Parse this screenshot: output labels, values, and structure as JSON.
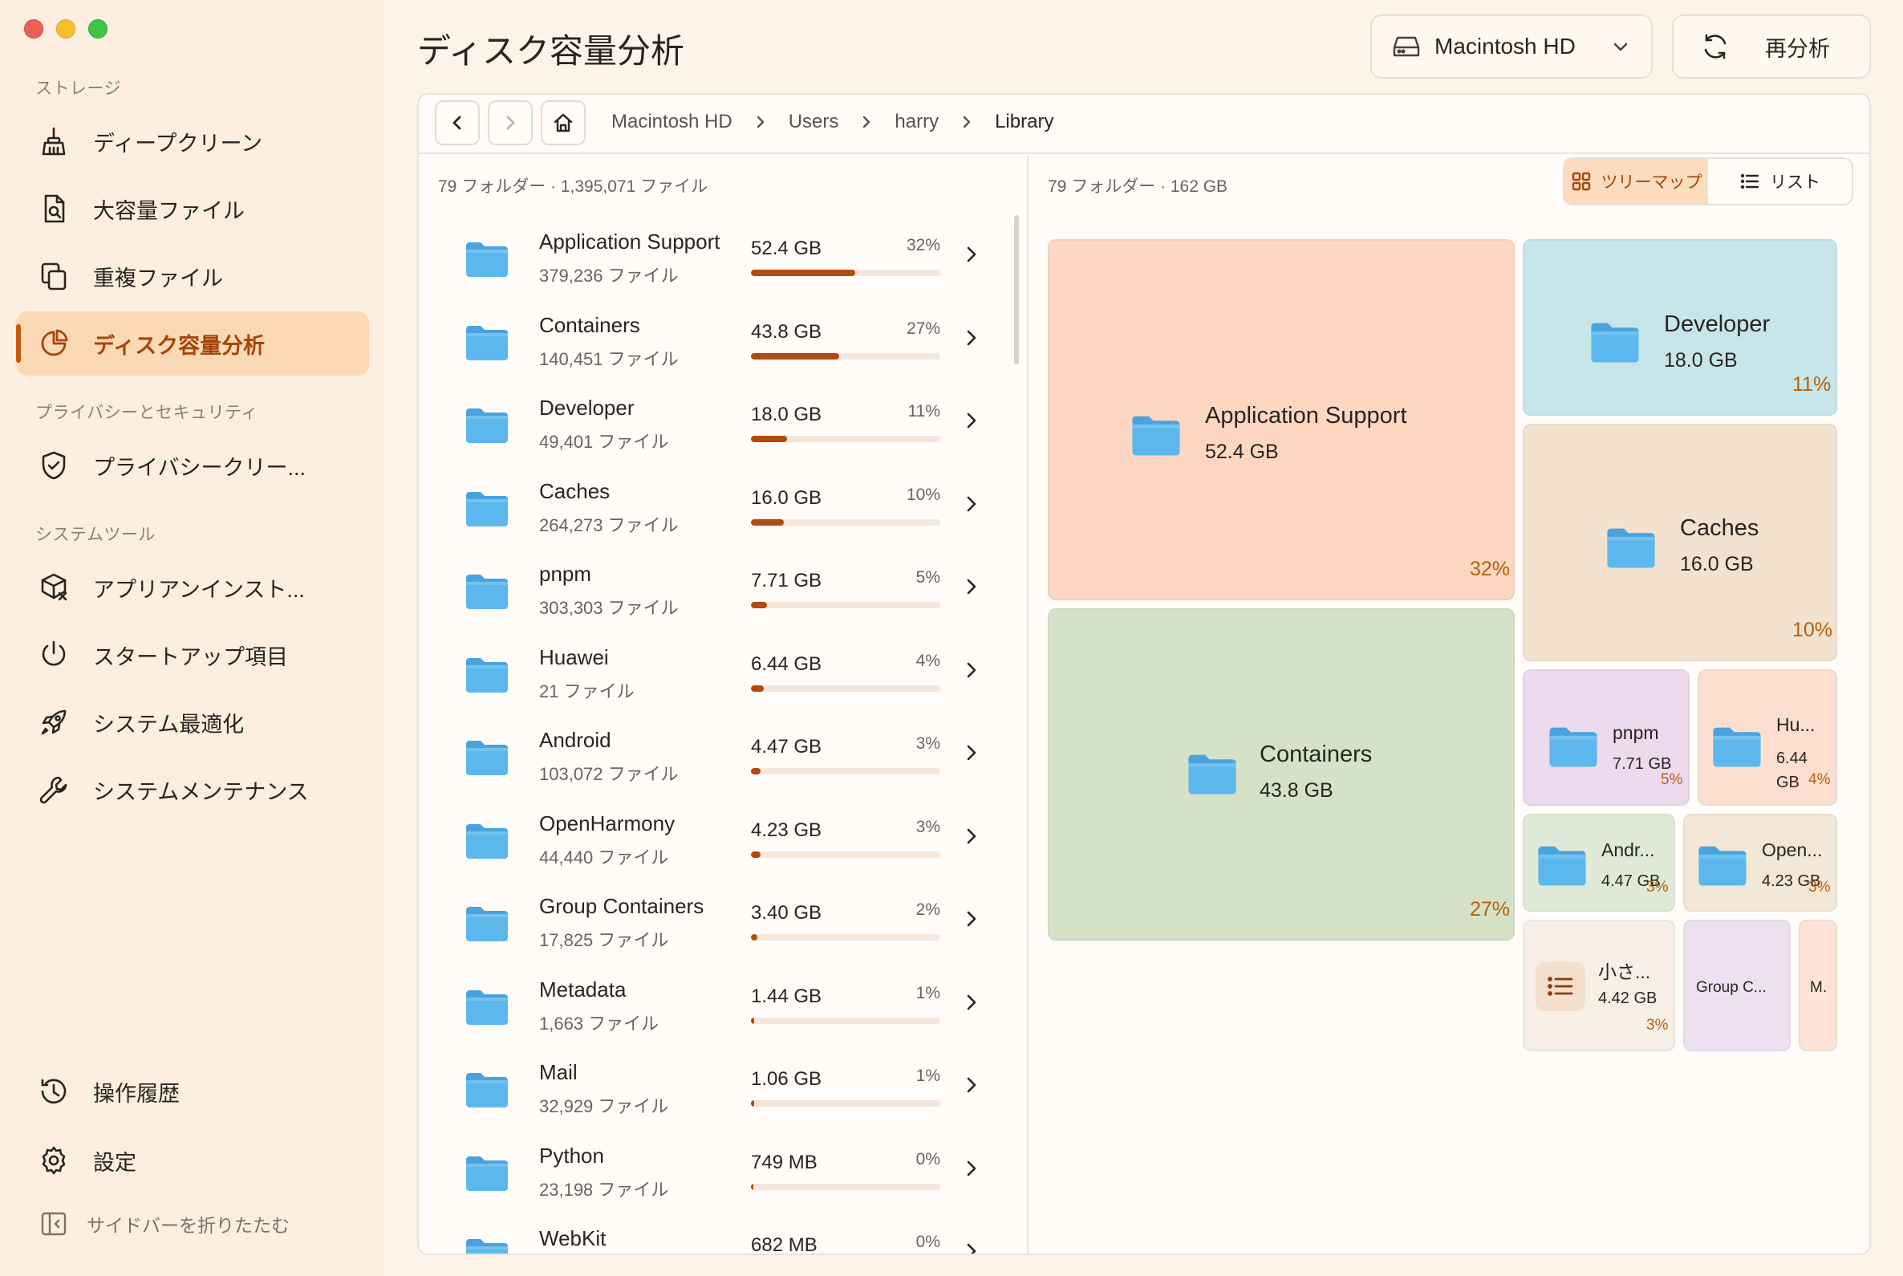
{
  "sidebar": {
    "sections": {
      "storage": "ストレージ",
      "privacy": "プライバシーとセキュリティ",
      "system": "システムツール"
    },
    "items": [
      {
        "label": "ディープクリーン",
        "icon": "broom-icon"
      },
      {
        "label": "大容量ファイル",
        "icon": "file-search-icon"
      },
      {
        "label": "重複ファイル",
        "icon": "duplicate-icon"
      },
      {
        "label": "ディスク容量分析",
        "icon": "pie-chart-icon",
        "active": true
      },
      {
        "label": "プライバシークリー...",
        "icon": "shield-check-icon"
      },
      {
        "label": "アプリアンインスト...",
        "icon": "package-remove-icon"
      },
      {
        "label": "スタートアップ項目",
        "icon": "power-icon"
      },
      {
        "label": "システム最適化",
        "icon": "rocket-icon"
      },
      {
        "label": "システムメンテナンス",
        "icon": "wrench-icon"
      },
      {
        "label": "操作履歴",
        "icon": "history-icon"
      },
      {
        "label": "設定",
        "icon": "gear-icon"
      }
    ],
    "collapse_label": "サイドバーを折りたたむ"
  },
  "header": {
    "title": "ディスク容量分析",
    "drive": "Macintosh HD",
    "rescan": "再分析"
  },
  "breadcrumb": [
    "Macintosh HD",
    "Users",
    "harry",
    "Library"
  ],
  "list": {
    "meta": "79 フォルダー · 1,395,071 ファイル",
    "rows": [
      {
        "name": "Application Support",
        "files": "379,236 ファイル",
        "size": "52.4 GB",
        "pct": "32%",
        "fraction": 0.32
      },
      {
        "name": "Containers",
        "files": "140,451 ファイル",
        "size": "43.8 GB",
        "pct": "27%",
        "fraction": 0.27
      },
      {
        "name": "Developer",
        "files": "49,401 ファイル",
        "size": "18.0 GB",
        "pct": "11%",
        "fraction": 0.11
      },
      {
        "name": "Caches",
        "files": "264,273 ファイル",
        "size": "16.0 GB",
        "pct": "10%",
        "fraction": 0.1
      },
      {
        "name": "pnpm",
        "files": "303,303 ファイル",
        "size": "7.71 GB",
        "pct": "5%",
        "fraction": 0.05
      },
      {
        "name": "Huawei",
        "files": "21 ファイル",
        "size": "6.44 GB",
        "pct": "4%",
        "fraction": 0.04
      },
      {
        "name": "Android",
        "files": "103,072 ファイル",
        "size": "4.47 GB",
        "pct": "3%",
        "fraction": 0.03
      },
      {
        "name": "OpenHarmony",
        "files": "44,440 ファイル",
        "size": "4.23 GB",
        "pct": "3%",
        "fraction": 0.03
      },
      {
        "name": "Group Containers",
        "files": "17,825 ファイル",
        "size": "3.40 GB",
        "pct": "2%",
        "fraction": 0.02
      },
      {
        "name": "Metadata",
        "files": "1,663 ファイル",
        "size": "1.44 GB",
        "pct": "1%",
        "fraction": 0.01
      },
      {
        "name": "Mail",
        "files": "32,929 ファイル",
        "size": "1.06 GB",
        "pct": "1%",
        "fraction": 0.01
      },
      {
        "name": "Python",
        "files": "23,198 ファイル",
        "size": "749 MB",
        "pct": "0%",
        "fraction": 0.005
      },
      {
        "name": "WebKit",
        "files": "",
        "size": "682 MB",
        "pct": "0%",
        "fraction": 0.004
      }
    ]
  },
  "treemap": {
    "meta": "79 フォルダー · 162 GB",
    "view_treemap": "ツリーマップ",
    "view_list": "リスト",
    "tiles": [
      {
        "name": "Application Support",
        "size": "52.4 GB",
        "pct": "32%",
        "color": "#fdd7c1"
      },
      {
        "name": "Developer",
        "size": "18.0 GB",
        "pct": "11%",
        "color": "#c7e6ea"
      },
      {
        "name": "Caches",
        "size": "16.0 GB",
        "pct": "10%",
        "color": "#f2e2cf"
      },
      {
        "name": "Containers",
        "size": "43.8 GB",
        "pct": "27%",
        "color": "#d5e2c7"
      },
      {
        "name": "pnpm",
        "size": "7.71 GB",
        "pct": "5%",
        "color": "#ecdaee"
      },
      {
        "name": "Hu...",
        "size": "6.44 GB",
        "pct": "4%",
        "color": "#fddfd2"
      },
      {
        "name": "Andr...",
        "size": "4.47 GB",
        "pct": "3%",
        "color": "#e1ead8"
      },
      {
        "name": "Open...",
        "size": "4.23 GB",
        "pct": "3%",
        "color": "#f3e8d8"
      },
      {
        "name": "小さ...",
        "size": "4.42 GB",
        "pct": "3%",
        "color": "#f7efe6"
      },
      {
        "name": "Group C...",
        "size": "",
        "pct": "",
        "color": "#ede0f0"
      },
      {
        "name": "M.",
        "size": "",
        "pct": "",
        "color": "#fde4d6"
      }
    ]
  }
}
